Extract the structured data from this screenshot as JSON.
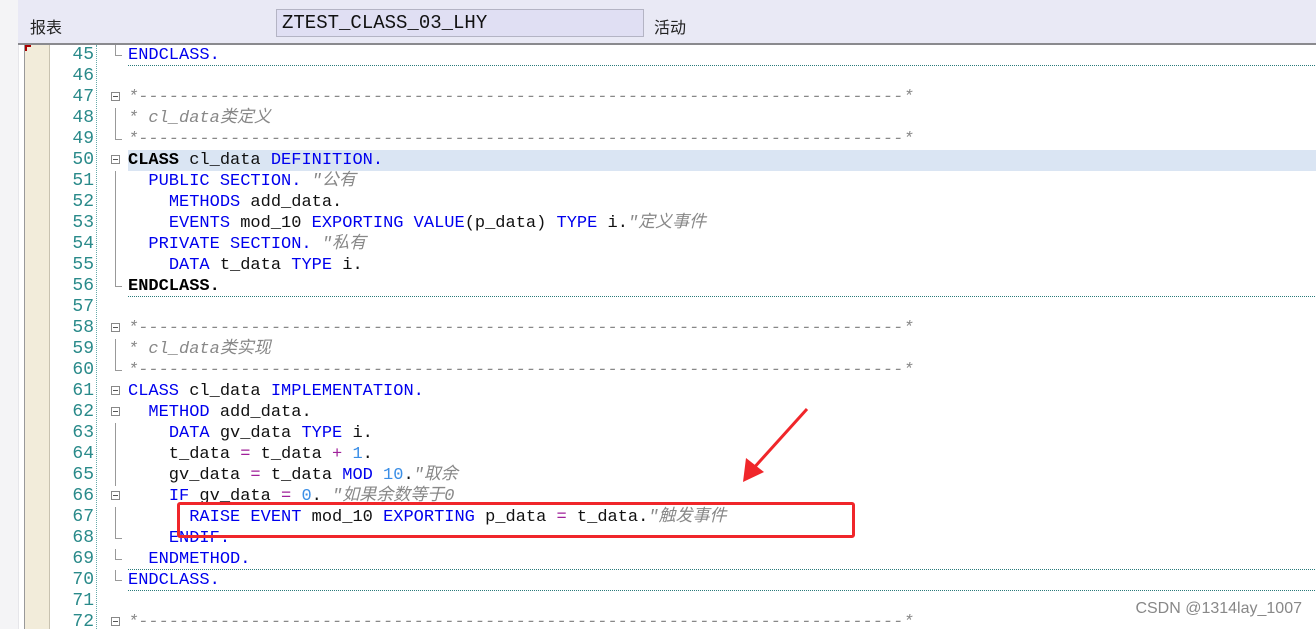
{
  "header": {
    "label": "报表",
    "program_name": "ZTEST_CLASS_03_LHY",
    "status": "活动"
  },
  "colors": {
    "keyword": "#0000ee",
    "comment": "#888888",
    "number": "#3a8ee6",
    "operator": "#a0209a",
    "highlight_box": "#f0262a"
  },
  "editor": {
    "lines": [
      {
        "n": "45",
        "fold": "end",
        "dotted": true,
        "t": [
          [
            "kw",
            "ENDCLASS."
          ]
        ]
      },
      {
        "n": "46",
        "t": []
      },
      {
        "n": "47",
        "fold": "open",
        "t": [
          [
            "cm",
            "*---------------------------------------------------------------------------*"
          ]
        ]
      },
      {
        "n": "48",
        "fold": "bar",
        "t": [
          [
            "cm",
            "* cl_data类定义"
          ]
        ]
      },
      {
        "n": "49",
        "fold": "end",
        "t": [
          [
            "cm",
            "*---------------------------------------------------------------------------*"
          ]
        ]
      },
      {
        "n": "50",
        "fold": "open",
        "hl": true,
        "t": [
          [
            "kb",
            "CLASS"
          ],
          [
            "id",
            " cl_data "
          ],
          [
            "kw",
            "DEFINITION."
          ]
        ]
      },
      {
        "n": "51",
        "fold": "bar",
        "t": [
          [
            "id",
            "  "
          ],
          [
            "kw",
            "PUBLIC SECTION."
          ],
          [
            "cm",
            " \"公有"
          ]
        ]
      },
      {
        "n": "52",
        "fold": "bar",
        "t": [
          [
            "id",
            "    "
          ],
          [
            "kw",
            "METHODS"
          ],
          [
            "id",
            " add_data."
          ]
        ]
      },
      {
        "n": "53",
        "fold": "bar",
        "t": [
          [
            "id",
            "    "
          ],
          [
            "kw",
            "EVENTS"
          ],
          [
            "id",
            " mod_10 "
          ],
          [
            "kw",
            "EXPORTING VALUE"
          ],
          [
            "id",
            "(p_data) "
          ],
          [
            "kw",
            "TYPE"
          ],
          [
            "id",
            " i."
          ],
          [
            "cm",
            "\"定义事件"
          ]
        ]
      },
      {
        "n": "54",
        "fold": "bar",
        "t": [
          [
            "id",
            "  "
          ],
          [
            "kw",
            "PRIVATE SECTION."
          ],
          [
            "cm",
            " \"私有"
          ]
        ]
      },
      {
        "n": "55",
        "fold": "bar",
        "t": [
          [
            "id",
            "    "
          ],
          [
            "kw",
            "DATA"
          ],
          [
            "id",
            " t_data "
          ],
          [
            "kw",
            "TYPE"
          ],
          [
            "id",
            " i."
          ]
        ]
      },
      {
        "n": "56",
        "fold": "end",
        "dotted": true,
        "t": [
          [
            "kb",
            "ENDCLASS."
          ]
        ]
      },
      {
        "n": "57",
        "t": []
      },
      {
        "n": "58",
        "fold": "open",
        "t": [
          [
            "cm",
            "*---------------------------------------------------------------------------*"
          ]
        ]
      },
      {
        "n": "59",
        "fold": "bar",
        "t": [
          [
            "cm",
            "* cl_data类实现"
          ]
        ]
      },
      {
        "n": "60",
        "fold": "end",
        "t": [
          [
            "cm",
            "*---------------------------------------------------------------------------*"
          ]
        ]
      },
      {
        "n": "61",
        "fold": "open",
        "t": [
          [
            "kw",
            "CLASS"
          ],
          [
            "id",
            " cl_data "
          ],
          [
            "kw",
            "IMPLEMENTATION."
          ]
        ]
      },
      {
        "n": "62",
        "fold": "open",
        "t": [
          [
            "id",
            "  "
          ],
          [
            "kw",
            "METHOD"
          ],
          [
            "id",
            " add_data."
          ]
        ]
      },
      {
        "n": "63",
        "fold": "bar",
        "t": [
          [
            "id",
            "    "
          ],
          [
            "kw",
            "DATA"
          ],
          [
            "id",
            " gv_data "
          ],
          [
            "kw",
            "TYPE"
          ],
          [
            "id",
            " i."
          ]
        ]
      },
      {
        "n": "64",
        "fold": "bar",
        "t": [
          [
            "id",
            "    t_data "
          ],
          [
            "op",
            "="
          ],
          [
            "id",
            " t_data "
          ],
          [
            "op",
            "+"
          ],
          [
            "nm",
            " 1"
          ],
          [
            "id",
            "."
          ]
        ]
      },
      {
        "n": "65",
        "fold": "bar",
        "t": [
          [
            "id",
            "    gv_data "
          ],
          [
            "op",
            "="
          ],
          [
            "id",
            " t_data "
          ],
          [
            "kw",
            "MOD"
          ],
          [
            "nm",
            " 10"
          ],
          [
            "id",
            "."
          ],
          [
            "cm",
            "\"取余"
          ]
        ]
      },
      {
        "n": "66",
        "fold": "open",
        "t": [
          [
            "id",
            "    "
          ],
          [
            "kw",
            "IF"
          ],
          [
            "id",
            " gv_data "
          ],
          [
            "op",
            "="
          ],
          [
            "nm",
            " 0"
          ],
          [
            "id",
            "."
          ],
          [
            "cm",
            " \"如果余数等于0"
          ]
        ]
      },
      {
        "n": "67",
        "fold": "bar",
        "t": [
          [
            "id",
            "      "
          ],
          [
            "kw",
            "RAISE EVENT"
          ],
          [
            "id",
            " mod_10 "
          ],
          [
            "kw",
            "EXPORTING"
          ],
          [
            "id",
            " p_data "
          ],
          [
            "op",
            "="
          ],
          [
            "id",
            " t_data."
          ],
          [
            "cm",
            "\"触发事件"
          ]
        ]
      },
      {
        "n": "68",
        "fold": "end",
        "t": [
          [
            "id",
            "    "
          ],
          [
            "kw",
            "ENDIF."
          ]
        ]
      },
      {
        "n": "69",
        "fold": "end",
        "dotted": true,
        "t": [
          [
            "id",
            "  "
          ],
          [
            "kw",
            "ENDMETHOD."
          ]
        ]
      },
      {
        "n": "70",
        "fold": "end",
        "dotted": true,
        "t": [
          [
            "kw",
            "ENDCLASS."
          ]
        ]
      },
      {
        "n": "71",
        "t": []
      },
      {
        "n": "72",
        "fold": "open",
        "t": [
          [
            "cm",
            "*---------------------------------------------------------------------------*"
          ]
        ]
      }
    ]
  },
  "watermark": "CSDN @1314lay_1007"
}
